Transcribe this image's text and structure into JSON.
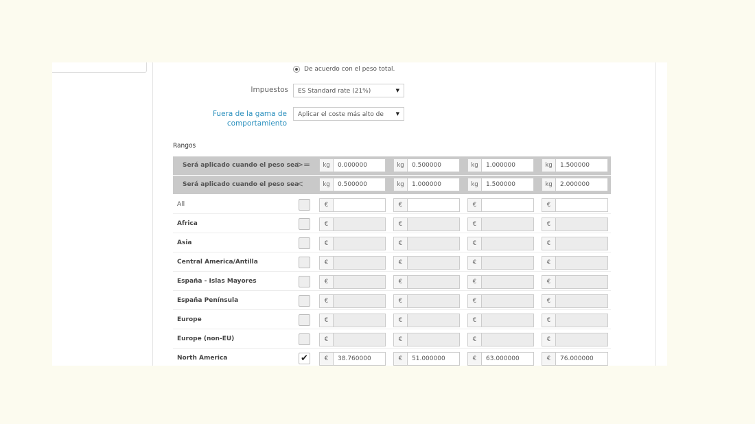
{
  "radio_option": "De acuerdo con el peso total.",
  "taxes": {
    "label": "Impuestos",
    "selected": "ES Standard rate (21%)"
  },
  "out_of_range": {
    "label_line1": "Fuera de la gama de",
    "label_line2": "comportamiento",
    "selected": "Aplicar el coste más alto de"
  },
  "ranges_title": "Rangos",
  "header_rows": [
    {
      "label": "Será aplicado cuando el peso sea",
      "operator": ">=",
      "unit": "kg",
      "values": [
        "0.000000",
        "0.500000",
        "1.000000",
        "1.500000"
      ]
    },
    {
      "label": "Será aplicado cuando el peso sea",
      "operator": "<",
      "unit": "kg",
      "values": [
        "0.500000",
        "1.000000",
        "1.500000",
        "2.000000"
      ]
    }
  ],
  "currency": "€",
  "zones": [
    {
      "name": "All",
      "checked": false,
      "enabled": true,
      "values": [
        "",
        "",
        "",
        ""
      ]
    },
    {
      "name": "Africa",
      "checked": false,
      "enabled": false,
      "values": [
        "",
        "",
        "",
        ""
      ]
    },
    {
      "name": "Asia",
      "checked": false,
      "enabled": false,
      "values": [
        "",
        "",
        "",
        ""
      ]
    },
    {
      "name": "Central America/Antilla",
      "checked": false,
      "enabled": false,
      "values": [
        "",
        "",
        "",
        ""
      ]
    },
    {
      "name": "España - Islas Mayores",
      "checked": false,
      "enabled": false,
      "values": [
        "",
        "",
        "",
        ""
      ]
    },
    {
      "name": "España Península",
      "checked": false,
      "enabled": false,
      "values": [
        "",
        "",
        "",
        ""
      ]
    },
    {
      "name": "Europe",
      "checked": false,
      "enabled": false,
      "values": [
        "",
        "",
        "",
        ""
      ]
    },
    {
      "name": "Europe (non-EU)",
      "checked": false,
      "enabled": false,
      "values": [
        "",
        "",
        "",
        ""
      ]
    },
    {
      "name": "North America",
      "checked": true,
      "enabled": true,
      "values": [
        "38.760000",
        "51.000000",
        "63.000000",
        "76.000000"
      ]
    }
  ],
  "icons": {
    "checkmark": "checkmark-icon",
    "caret": "caret-down-icon",
    "radio": "radio-selected-icon"
  }
}
